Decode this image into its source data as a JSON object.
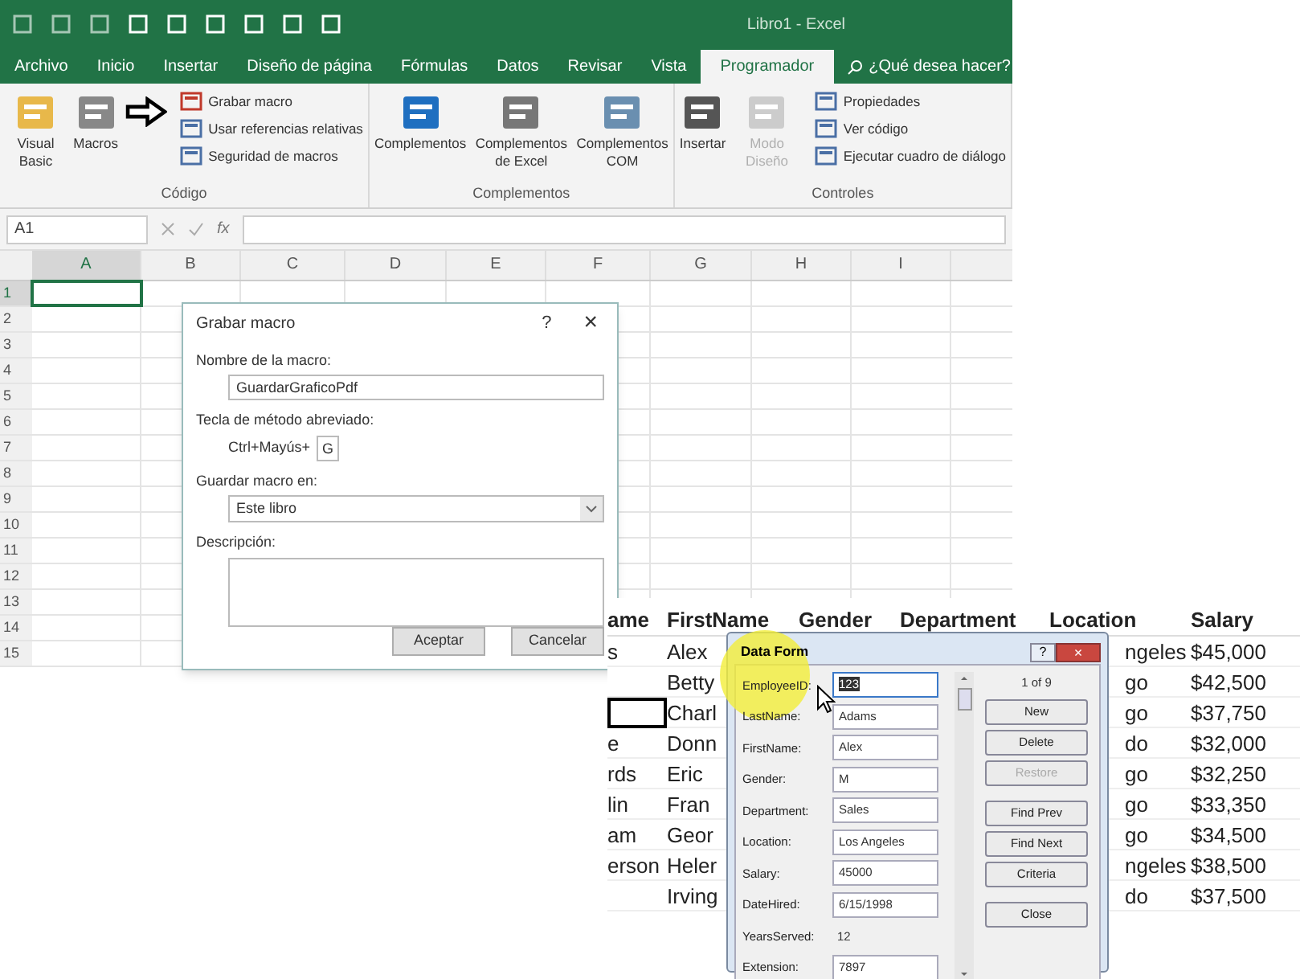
{
  "excel": {
    "title": "Libro1 - Excel",
    "tabs": [
      {
        "label": "Archivo",
        "selected": false
      },
      {
        "label": "Inicio",
        "selected": false
      },
      {
        "label": "Insertar",
        "selected": false
      },
      {
        "label": "Diseño de página",
        "selected": false
      },
      {
        "label": "Fórmulas",
        "selected": false
      },
      {
        "label": "Datos",
        "selected": false
      },
      {
        "label": "Revisar",
        "selected": false
      },
      {
        "label": "Vista",
        "selected": false
      },
      {
        "label": "Programador",
        "selected": true
      }
    ],
    "tell_me": "¿Qué desea hacer?",
    "groups": [
      {
        "label": "Código",
        "large": [
          {
            "label": "Visual Basic",
            "disabled": false
          },
          {
            "label": "Macros",
            "disabled": false
          }
        ],
        "small": [
          "Grabar macro",
          "Usar referencias relativas",
          "Seguridad de macros"
        ]
      },
      {
        "label": "Complementos",
        "large": [
          {
            "label": "Complementos",
            "disabled": false
          },
          {
            "label": "Complementos de Excel",
            "disabled": false
          },
          {
            "label": "Complementos COM",
            "disabled": false
          }
        ]
      },
      {
        "label": "Controles",
        "large": [
          {
            "label": "Insertar",
            "disabled": false
          },
          {
            "label": "Modo Diseño",
            "disabled": true
          }
        ],
        "small": [
          "Propiedades",
          "Ver código",
          "Ejecutar cuadro de diálogo"
        ]
      }
    ],
    "name_box": "A1",
    "fx": "fx",
    "columns": [
      {
        "label": "A",
        "selected": true
      },
      {
        "label": "B",
        "selected": false
      },
      {
        "label": "C",
        "selected": false
      },
      {
        "label": "D",
        "selected": false
      },
      {
        "label": "E",
        "selected": false
      },
      {
        "label": "F",
        "selected": false
      },
      {
        "label": "G",
        "selected": false
      },
      {
        "label": "H",
        "selected": false
      },
      {
        "label": "I",
        "selected": false
      }
    ],
    "rows": [
      {
        "label": "1",
        "selected": true
      },
      {
        "label": "2",
        "selected": false
      },
      {
        "label": "3",
        "selected": false
      },
      {
        "label": "4",
        "selected": false
      },
      {
        "label": "5",
        "selected": false
      },
      {
        "label": "6",
        "selected": false
      },
      {
        "label": "7",
        "selected": false
      },
      {
        "label": "8",
        "selected": false
      },
      {
        "label": "9",
        "selected": false
      },
      {
        "label": "10",
        "selected": false
      },
      {
        "label": "11",
        "selected": false
      },
      {
        "label": "12",
        "selected": false
      },
      {
        "label": "13",
        "selected": false
      },
      {
        "label": "14",
        "selected": false
      },
      {
        "label": "15",
        "selected": false
      }
    ],
    "dialog": {
      "title": "Grabar macro",
      "help": "?",
      "close": "×",
      "name_label": "Nombre de la macro:",
      "name_value": "GuardarGraficoPdf",
      "shortcut_label": "Tecla de método abreviado:",
      "shortcut_prefix": "Ctrl+Mayús+",
      "shortcut_value": "G",
      "store_label": "Guardar macro en:",
      "store_value": "Este libro",
      "description_label": "Descripción:",
      "buttons": [
        "Aceptar",
        "Cancelar"
      ]
    }
  },
  "inset": {
    "columns": [
      "ame",
      "FirstName",
      "Gender",
      "Department",
      "Location",
      "Salary"
    ],
    "rows": [
      {
        "column_1": "s",
        "first_name": "Alex",
        "location": "ngeles",
        "salary": "$45,000",
        "selected": false
      },
      {
        "first_name": "Betty",
        "location": "go",
        "salary": "$42,500",
        "selected": false
      },
      {
        "first_name": "Charl",
        "location": "go",
        "salary": "$37,750",
        "selected": true
      },
      {
        "column_1": "e",
        "first_name": "Donn",
        "location": "do",
        "salary": "$32,000",
        "selected": false
      },
      {
        "column_1": "rds",
        "first_name": "Eric",
        "location": "go",
        "salary": "$32,250",
        "selected": false
      },
      {
        "column_1": "lin",
        "first_name": "Fran",
        "location": "go",
        "salary": "$33,350",
        "selected": false
      },
      {
        "column_1": "am",
        "first_name": "Geor",
        "location": "go",
        "salary": "$34,500",
        "selected": false
      },
      {
        "column_1": "erson",
        "first_name": "Heler",
        "location": "ngeles",
        "salary": "$38,500",
        "selected": false
      },
      {
        "first_name": "Irving",
        "location": "do",
        "salary": "$37,500",
        "selected": false
      }
    ],
    "form": {
      "title": "Data Form",
      "help": "?",
      "close": "×",
      "record": "1 of 9",
      "fields": [
        {
          "label": "EmployeeID:",
          "value": "123",
          "kind": "input",
          "selected": true
        },
        {
          "label": "LastName:",
          "value": "Adams",
          "kind": "input",
          "selected": false
        },
        {
          "label": "FirstName:",
          "value": "Alex",
          "kind": "input",
          "selected": false
        },
        {
          "label": "Gender:",
          "value": "M",
          "kind": "input",
          "selected": false
        },
        {
          "label": "Department:",
          "value": "Sales",
          "kind": "input",
          "selected": false
        },
        {
          "label": "Location:",
          "value": "Los Angeles",
          "kind": "input",
          "selected": false
        },
        {
          "label": "Salary:",
          "value": "45000",
          "kind": "input",
          "selected": false
        },
        {
          "label": "DateHired:",
          "value": "6/15/1998",
          "kind": "input",
          "selected": false
        },
        {
          "label": "YearsServed:",
          "value": "12",
          "kind": "plain",
          "selected": false
        },
        {
          "label": "Extension:",
          "value": "7897",
          "kind": "input",
          "selected": false
        }
      ],
      "buttons": [
        {
          "label": "New",
          "disabled": false
        },
        {
          "label": "Delete",
          "disabled": false
        },
        {
          "label": "Restore",
          "disabled": true
        },
        {
          "label": "Find Prev",
          "disabled": false
        },
        {
          "label": "Find Next",
          "disabled": false
        },
        {
          "label": "Criteria",
          "disabled": false
        },
        {
          "label": "Close",
          "disabled": false
        }
      ]
    }
  }
}
